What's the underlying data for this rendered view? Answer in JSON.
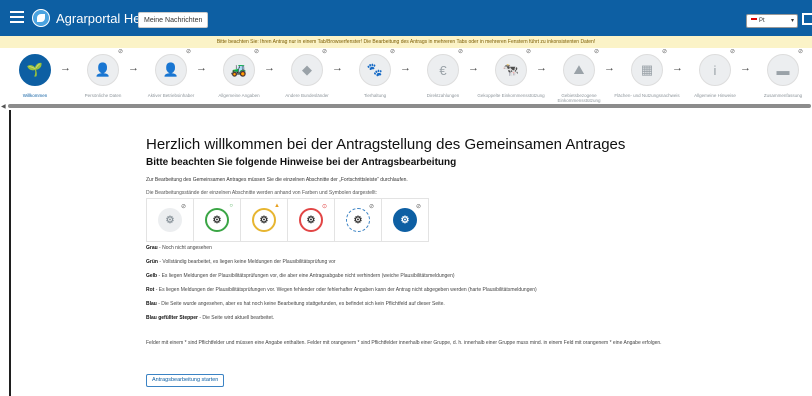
{
  "header": {
    "menu_icon": "hamburger-icon",
    "logo_icon": "leaf-logo-icon",
    "app_title": "Agrarportal Hessen",
    "messages_button": "Meine Nachrichten",
    "language": "Pt",
    "help_icon": "book-icon"
  },
  "notice": "Bitte beachten Sie: Ihren Antrag nur in einem Tab/Browserfenster! Die Bearbeitung des Antrags in mehreren Tabs oder in mehreren Fenstern führt zu inkonsistenten Daten!",
  "stepper": {
    "arrow_icon": "arrow-right-icon",
    "eye_icon": "eye-off-icon",
    "steps": [
      {
        "label": "Willkommen",
        "icon": "sprout-icon",
        "glyph": "🌱"
      },
      {
        "label": "Persönliche Daten",
        "icon": "person-card-icon",
        "glyph": "👤"
      },
      {
        "label": "Aktiver Betriebsinhaber",
        "icon": "person-icon",
        "glyph": "👤"
      },
      {
        "label": "Allgemeine Angaben",
        "icon": "tractor-icon",
        "glyph": "🚜"
      },
      {
        "label": "Andere Bundesländer",
        "icon": "map-icon",
        "glyph": "◆"
      },
      {
        "label": "Tierhaltung",
        "icon": "paw-icon",
        "glyph": "🐾"
      },
      {
        "label": "Direktzahlungen",
        "icon": "euro-icon",
        "glyph": "€"
      },
      {
        "label": "Gekoppelte Einkommensstützung",
        "icon": "cow-icon",
        "glyph": "🐄"
      },
      {
        "label": "Gebietsbezogene Einkommensstützung",
        "icon": "hiker-icon",
        "glyph": "⛰"
      },
      {
        "label": "Flächen- und Nutzungsnachweis",
        "icon": "fields-icon",
        "glyph": "▦"
      },
      {
        "label": "Allgemeine Hinweise",
        "icon": "info-icon",
        "glyph": "i"
      },
      {
        "label": "Zusammenfassung",
        "icon": "folder-icon",
        "glyph": "▬"
      }
    ]
  },
  "main": {
    "title": "Herzlich willkommen bei der Antragstellung des Gemeinsamen Antrages",
    "subtitle": "Bitte beachten Sie folgende Hinweise bei der Antragsbearbeitung",
    "intro": "Zur Bearbeitung des Gemeinsamen Antrages müssen Sie die einzelnen Abschnitte der „Fortschrittsleiste“ durchlaufen.",
    "intro2": "Die Bearbeitungsstände der einzelnen Abschnitte werden anhand von Farben und Symbolen dargestellt:",
    "status_icons": [
      {
        "style": "grey",
        "icon": "tractor-grey-icon",
        "mark": "eye-off"
      },
      {
        "style": "green",
        "icon": "tractor-green-icon",
        "mark": "check"
      },
      {
        "style": "yellow",
        "icon": "tractor-yellow-icon",
        "mark": "warning"
      },
      {
        "style": "red",
        "icon": "tractor-red-icon",
        "mark": "error"
      },
      {
        "style": "blue",
        "icon": "tractor-blue-icon",
        "mark": "eye-off"
      },
      {
        "style": "filled",
        "icon": "tractor-filled-icon",
        "mark": "eye-off"
      }
    ],
    "legend": [
      {
        "term": "Grau",
        "text": " - Noch nicht angesehen"
      },
      {
        "term": "Grün",
        "text": " - Vollständig bearbeitet, es liegen keine Meldungen der Plausibilitätsprüfung vor"
      },
      {
        "term": "Gelb",
        "text": " - Es liegen Meldungen der Plausibilitätsprüfungen vor, die aber eine Antragsabgabe nicht verhindern (weiche Plausibilitätsmeldungen)"
      },
      {
        "term": "Rot",
        "text": " - Es liegen Meldungen der Plausibilitätsprüfungen vor. Wegen fehlender oder fehlerhafter Angaben kann der Antrag nicht abgegeben werden (harte Plausibilitätsmeldungen)"
      },
      {
        "term": "Blau",
        "text": " - Die Seite wurde angesehen, aber es hat noch keine Bearbeitung stattgefunden, es befindet sich kein Pflichtfeld auf dieser Seite."
      },
      {
        "term": "Blau gefüllter Stepper",
        "text": " - Die Seite wird aktuell bearbeitet."
      }
    ],
    "footer_text": "Felder mit einem * sind Pflichtfelder und müssen eine Angabe enthalten. Felder mit orangenem * sind Pflichtfelder innerhalb einer Gruppe, d. h. innerhalb einer Gruppe muss mind. in einem Feld mit orangenem * eine Angabe erfolgen.",
    "start_button": "Antragsbearbeitung starten"
  }
}
